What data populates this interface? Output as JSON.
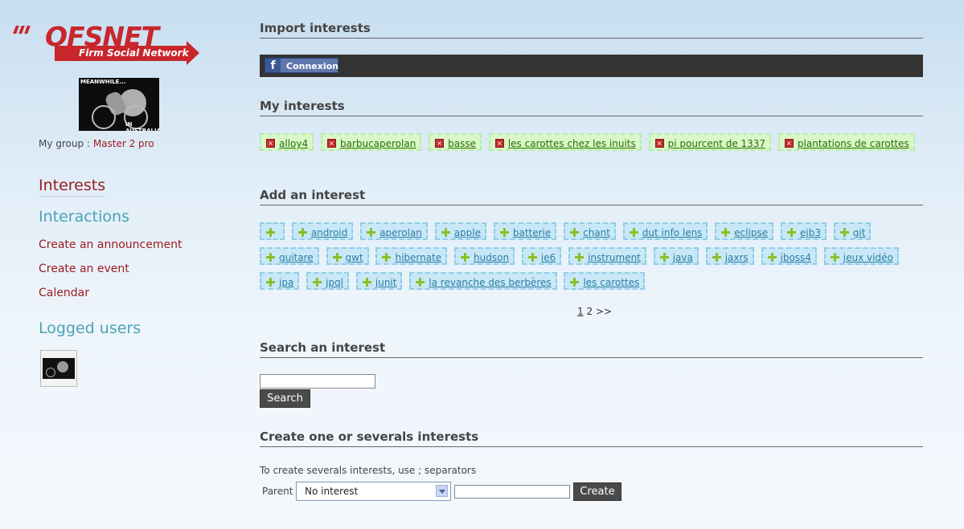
{
  "colors": {
    "accent_red": "#9e1c20",
    "accent_teal": "#4aa3b5",
    "link_blue": "#1c6ea4"
  },
  "logo": {
    "word": "OFSNET",
    "tagline": "Firm Social Network"
  },
  "group_image": {
    "caption_top": "MEANWHILE...",
    "caption_bottom": "IN AUSTRALIA"
  },
  "sidebar": {
    "group_label": "My group :",
    "group_value": "Master 2 pro",
    "interests": "Interests",
    "interactions": "Interactions",
    "links": [
      "Create an announcement",
      "Create an event",
      "Calendar"
    ],
    "logged_users": "Logged users"
  },
  "import": {
    "title": "Import interests",
    "facebook_button": "Connexion"
  },
  "my_interests": {
    "title": "My interests",
    "items": [
      "alloy4",
      "barbucaperolan",
      "basse",
      "les carottes chez les inuits",
      "pi pourcent de 1337",
      "plantations de carottes"
    ]
  },
  "add_interest": {
    "title": "Add an interest",
    "items": [
      "",
      "android",
      "aperolan",
      "apple",
      "batterie",
      "chant",
      "dut info lens",
      "eclipse",
      "ejb3",
      "git",
      "guitare",
      "gwt",
      "hibernate",
      "hudson",
      "ie6",
      "instrument",
      "java",
      "jaxrs",
      "jboss4",
      "jeux vidéo",
      "jpa",
      "jpql",
      "junit",
      "la revanche des berbères",
      "les carottes"
    ],
    "pager": {
      "current": "1",
      "next": "2",
      "more": ">>"
    }
  },
  "search": {
    "title": "Search an interest",
    "input_value": "",
    "button": "Search"
  },
  "create": {
    "title": "Create one or severals interests",
    "help": "To create severals interests, use ; separators",
    "parent_label": "Parent",
    "parent_selected": "No interest",
    "name_value": "",
    "button": "Create"
  }
}
